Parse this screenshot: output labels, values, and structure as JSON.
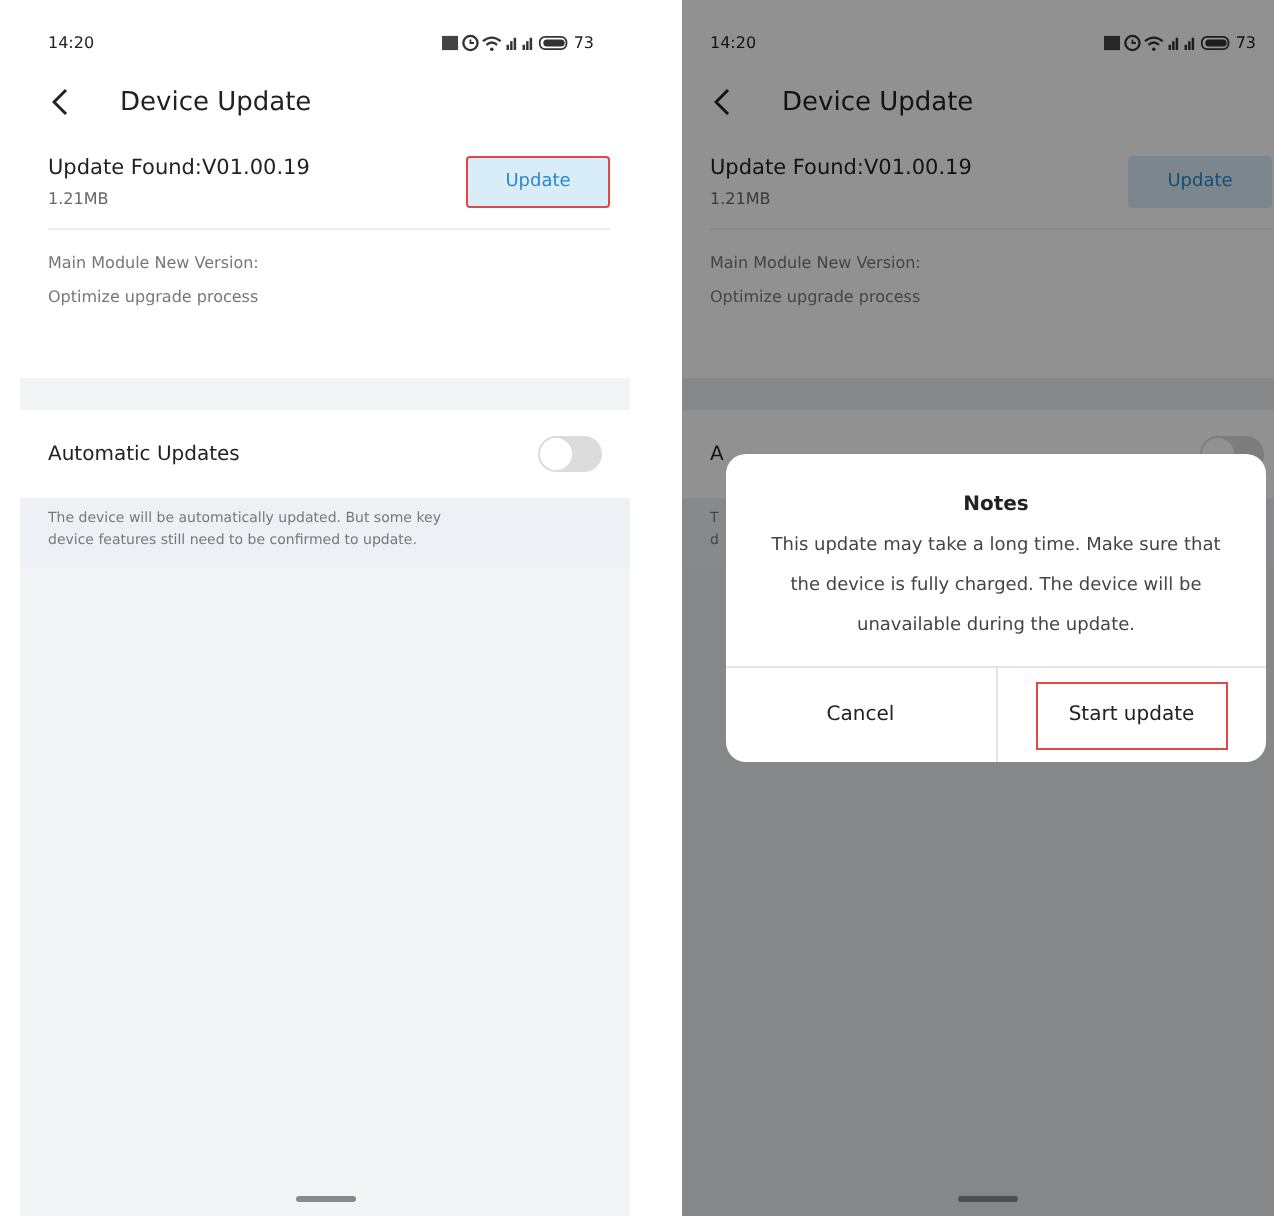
{
  "screens": [
    {
      "dimmed": false,
      "status_bar": {
        "time": "14:20",
        "battery": "73"
      },
      "title": "Device Update",
      "update": {
        "heading": "Update Found:V01.00.19",
        "size": "1.21MB",
        "button": {
          "label": "Update",
          "highlighted": true
        }
      },
      "notes_lines": [
        "Main Module New Version:",
        "Optimize upgrade process"
      ],
      "auto_update": {
        "label": "Automatic Updates",
        "on": false
      },
      "description_lines": [
        "The device will be automatically updated. But some key",
        "device features still need to be confirmed to update."
      ]
    },
    {
      "dimmed": true,
      "status_bar": {
        "time": "14:20",
        "battery": "73"
      },
      "title": "Device Update",
      "update": {
        "heading": "Update Found:V01.00.19",
        "size": "1.21MB",
        "button": {
          "label": "Update",
          "highlighted": false
        }
      },
      "notes_lines": [
        "Main Module New Version:",
        "Optimize upgrade process"
      ],
      "auto_update": {
        "label": "A",
        "on": false
      },
      "description_lines": [
        "T",
        "d"
      ],
      "dialog": {
        "title": "Notes",
        "message": "This update may take a long time. Make sure that the device is fully charged. The device will be unavailable during the update.",
        "buttons": [
          {
            "label": "Cancel",
            "highlighted": false
          },
          {
            "label": "Start update",
            "highlighted": true
          }
        ]
      }
    }
  ]
}
